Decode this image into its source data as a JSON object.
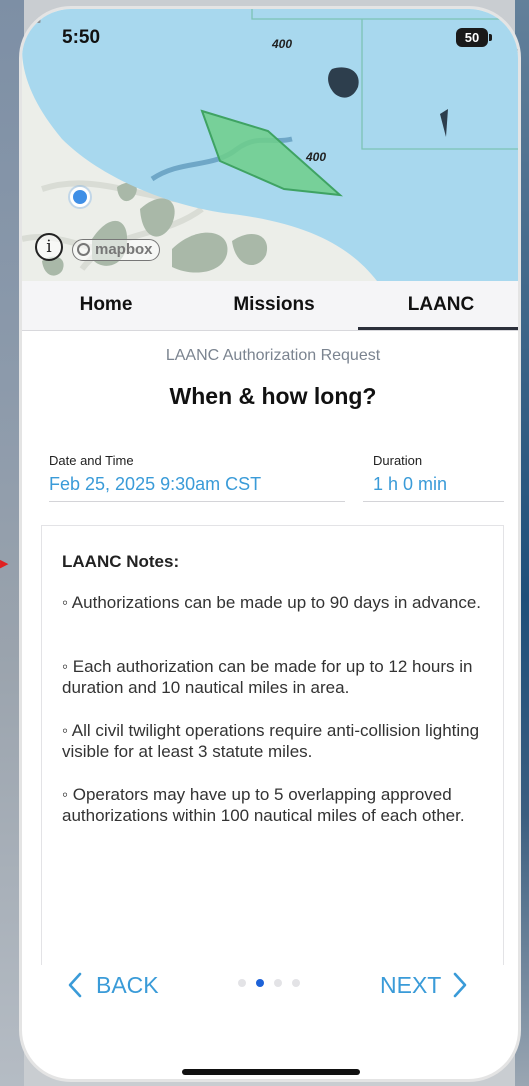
{
  "status_bar": {
    "time": "5:50",
    "battery": "50",
    "icons": [
      "location-arrow-icon",
      "signal-icon",
      "wifi-icon",
      "battery-icon"
    ]
  },
  "map": {
    "altitude_labels": [
      "400",
      "400"
    ],
    "attribution": "mapbox",
    "icons": [
      "info-icon",
      "mapbox-logo",
      "location-dot"
    ]
  },
  "tabs": [
    {
      "label": "Home",
      "active": false
    },
    {
      "label": "Missions",
      "active": false
    },
    {
      "label": "LAANC",
      "active": true
    }
  ],
  "page": {
    "subtitle": "LAANC Authorization Request",
    "heading": "When & how long?"
  },
  "fields": {
    "date_label": "Date and Time",
    "date_value": "Feb 25, 2025 9:30am CST",
    "duration_label": "Duration",
    "duration_value": "1 h 0 min"
  },
  "notes": {
    "title": "LAANC Notes:",
    "items": [
      "◦ Authorizations can be made up to 90 days in advance.",
      "◦ Each authorization can be made for up to 12 hours in duration and 10 nautical miles in area.",
      "◦ All civil twilight operations require anti-collision lighting visible for at least 3 statute miles.",
      "◦ Operators may have up to 5 overlapping approved authorizations within 100 nautical miles of each other."
    ]
  },
  "nav": {
    "back_label": "BACK",
    "next_label": "NEXT",
    "page_count": 4,
    "active_page": 2
  },
  "colors": {
    "accent": "#3a9bd8",
    "airspace": "#a8d8ee",
    "authorized_area": "#6fcf8a",
    "active_dot": "#1d62d8"
  }
}
